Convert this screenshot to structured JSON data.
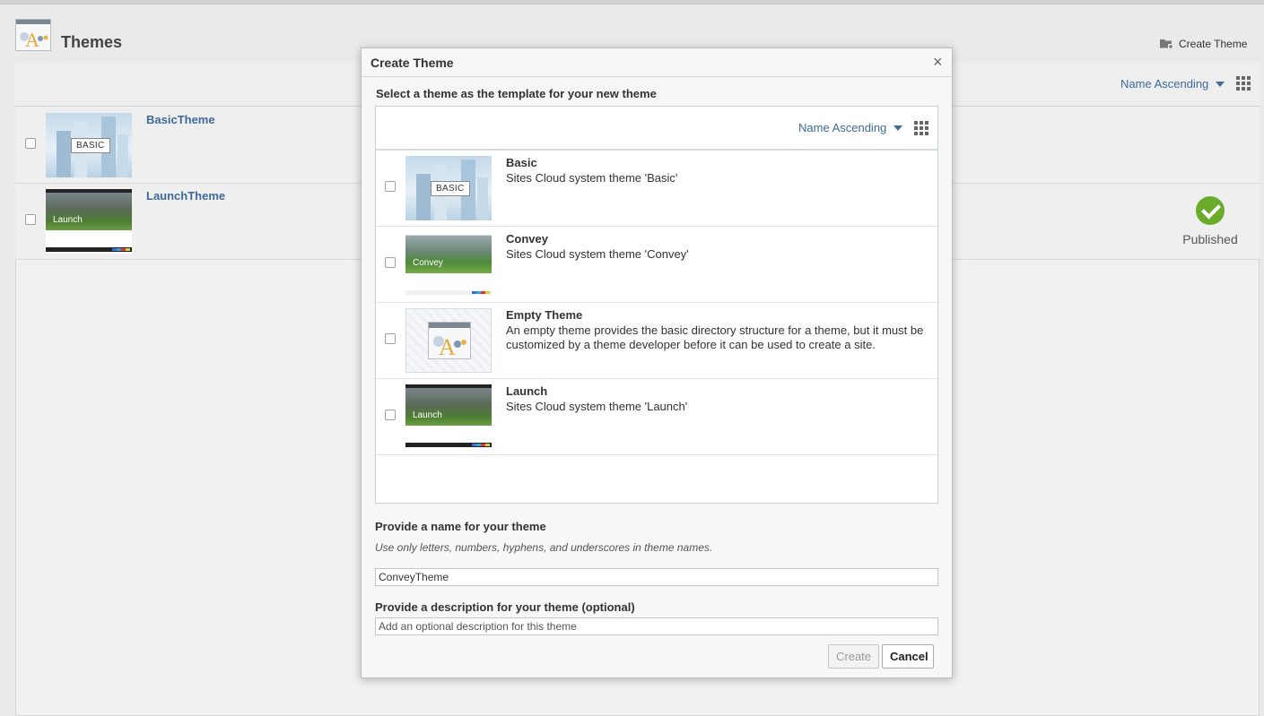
{
  "page": {
    "title": "Themes",
    "create_theme_label": "Create Theme",
    "sort_label": "Name Ascending",
    "rows": [
      {
        "name": "BasicTheme",
        "status": ""
      },
      {
        "name": "LaunchTheme",
        "status": "Published"
      }
    ]
  },
  "dialog": {
    "title": "Create Theme",
    "close_glyph": "×",
    "template_prompt": "Select a theme as the template for your new theme",
    "sort_label": "Name Ascending",
    "templates": [
      {
        "name": "Basic",
        "description": "Sites Cloud system theme 'Basic'",
        "thumb_text": "BASIC"
      },
      {
        "name": "Convey",
        "description": "Sites Cloud system theme 'Convey'",
        "thumb_text": "Convey"
      },
      {
        "name": "Empty Theme",
        "description": "An empty theme provides the basic directory structure for a theme, but it must be customized by a theme developer before it can be used to create a site.",
        "thumb_text": ""
      },
      {
        "name": "Launch",
        "description": "Sites Cloud system theme 'Launch'",
        "thumb_text": "Launch"
      }
    ],
    "name_label": "Provide a name for your theme",
    "name_hint": "Use only letters, numbers, hyphens, and underscores in theme names.",
    "name_value": "ConveyTheme",
    "desc_label": "Provide a description for your theme (optional)",
    "desc_placeholder": "Add an optional description for this theme",
    "create_label": "Create",
    "cancel_label": "Cancel"
  },
  "colors": {
    "link": "#3e6a9c",
    "published_check": "#6aab2a"
  },
  "icons": [
    "themes-app-icon",
    "add-folder-icon",
    "caret-down-icon",
    "grid-view-icon",
    "check-circle-icon",
    "close-icon"
  ]
}
